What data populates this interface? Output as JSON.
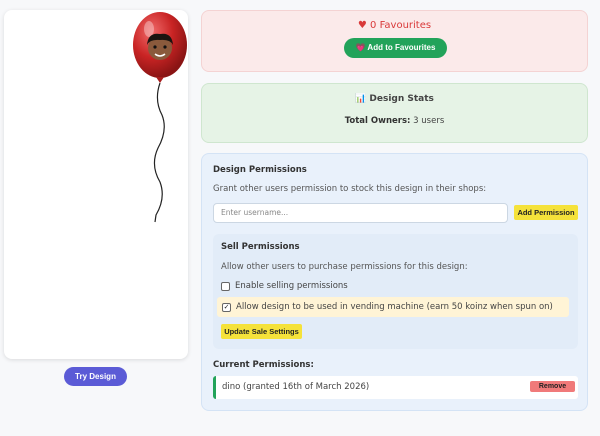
{
  "preview": {
    "try_label": "Try Design"
  },
  "favourites": {
    "count_text": "♥ 0 Favourites",
    "button_label": "💗 Add to Favourites"
  },
  "stats": {
    "title": "📊 Design Stats",
    "owners_label": "Total Owners:",
    "owners_value": " 3 users"
  },
  "permissions": {
    "title": "Design Permissions",
    "description": "Grant other users permission to stock this design in their shops:",
    "input_placeholder": "Enter username...",
    "add_label": "Add Permission",
    "sell": {
      "title": "Sell Permissions",
      "description": "Allow other users to purchase permissions for this design:",
      "enable_label": "Enable selling permissions",
      "enable_checked": false,
      "vending_label": "Allow design to be used in vending machine (earn 50 koinz when spun on)",
      "vending_checked": true,
      "update_label": "Update Sale Settings"
    },
    "current_title": "Current Permissions:",
    "current": [
      {
        "text": "dino (granted 16th of March 2026)",
        "remove_label": "Remove"
      }
    ]
  },
  "colors": {
    "accent_purple": "#5b5bd6",
    "accent_green": "#22a35a",
    "accent_yellow": "#f5e23a",
    "danger": "#f07a7a"
  }
}
